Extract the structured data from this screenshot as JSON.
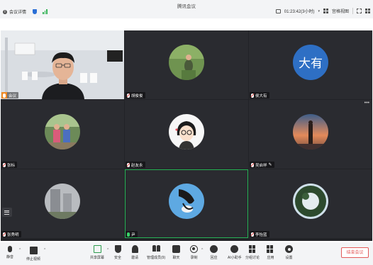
{
  "app": {
    "title": "腾讯会议"
  },
  "topbar": {
    "meeting_info_label": "会议详情",
    "recording_time": "01:23:42(3小时)",
    "view_label": "宫格视图"
  },
  "participants": [
    {
      "name": "会议",
      "muted": false,
      "host": true
    },
    {
      "name": "胡俊俊",
      "muted": true
    },
    {
      "name": "侯大有",
      "muted": true,
      "avatar_text": "大有",
      "avatar_color": "#2e6fc4"
    },
    {
      "name": "张标",
      "muted": true
    },
    {
      "name": "赵友永",
      "muted": true
    },
    {
      "name": "吴启祥",
      "muted": true,
      "editing": true
    },
    {
      "name": "张秀明",
      "muted": true
    },
    {
      "name": "尹",
      "muted": false,
      "speaking": true
    },
    {
      "name": "李怡蓝",
      "muted": true
    }
  ],
  "toolbar": {
    "mute_label": "静音",
    "video_label": "停止视频",
    "share_label": "共享屏幕",
    "security_label": "安全",
    "invite_label": "邀请",
    "members_label": "管理成员(9)",
    "chat_label": "聊天",
    "record_label": "录制",
    "reactions_label": "回应",
    "ai_label": "AI小助手",
    "breakout_label": "分组讨论",
    "apps_label": "应用",
    "settings_label": "设置",
    "end_label": "结束会议"
  },
  "colors": {
    "grid_bg": "#222327",
    "tile_bg": "#2a2b30",
    "active_border": "#27b356",
    "end_red": "#e35a5a",
    "accent_green": "#2b9b4c"
  }
}
